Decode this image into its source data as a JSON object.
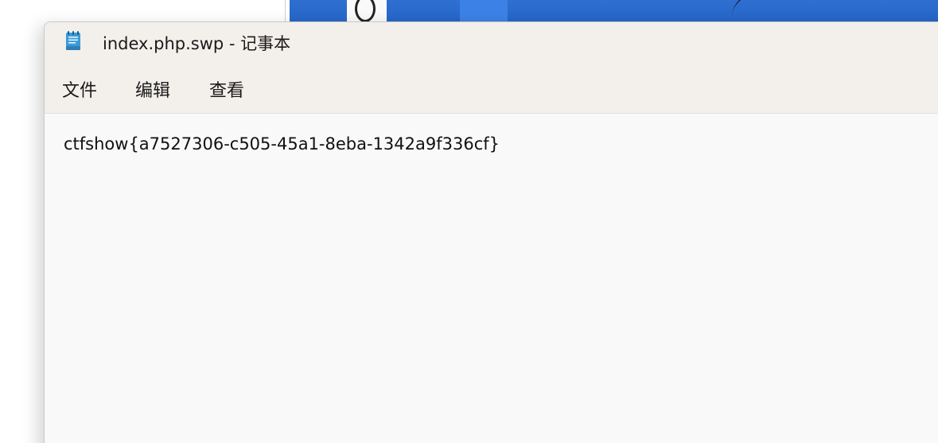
{
  "window": {
    "title": "index.php.swp - 记事本",
    "app_icon": "notepad-icon"
  },
  "menu": {
    "file": "文件",
    "edit": "编辑",
    "view": "查看"
  },
  "editor": {
    "content": "ctfshow{a7527306-c505-45a1-8eba-1342a9f336cf}"
  },
  "colors": {
    "titlebar_bg": "#f3f0ec",
    "editor_bg": "#f9f9f9",
    "desktop_accent": "#2565c8"
  }
}
